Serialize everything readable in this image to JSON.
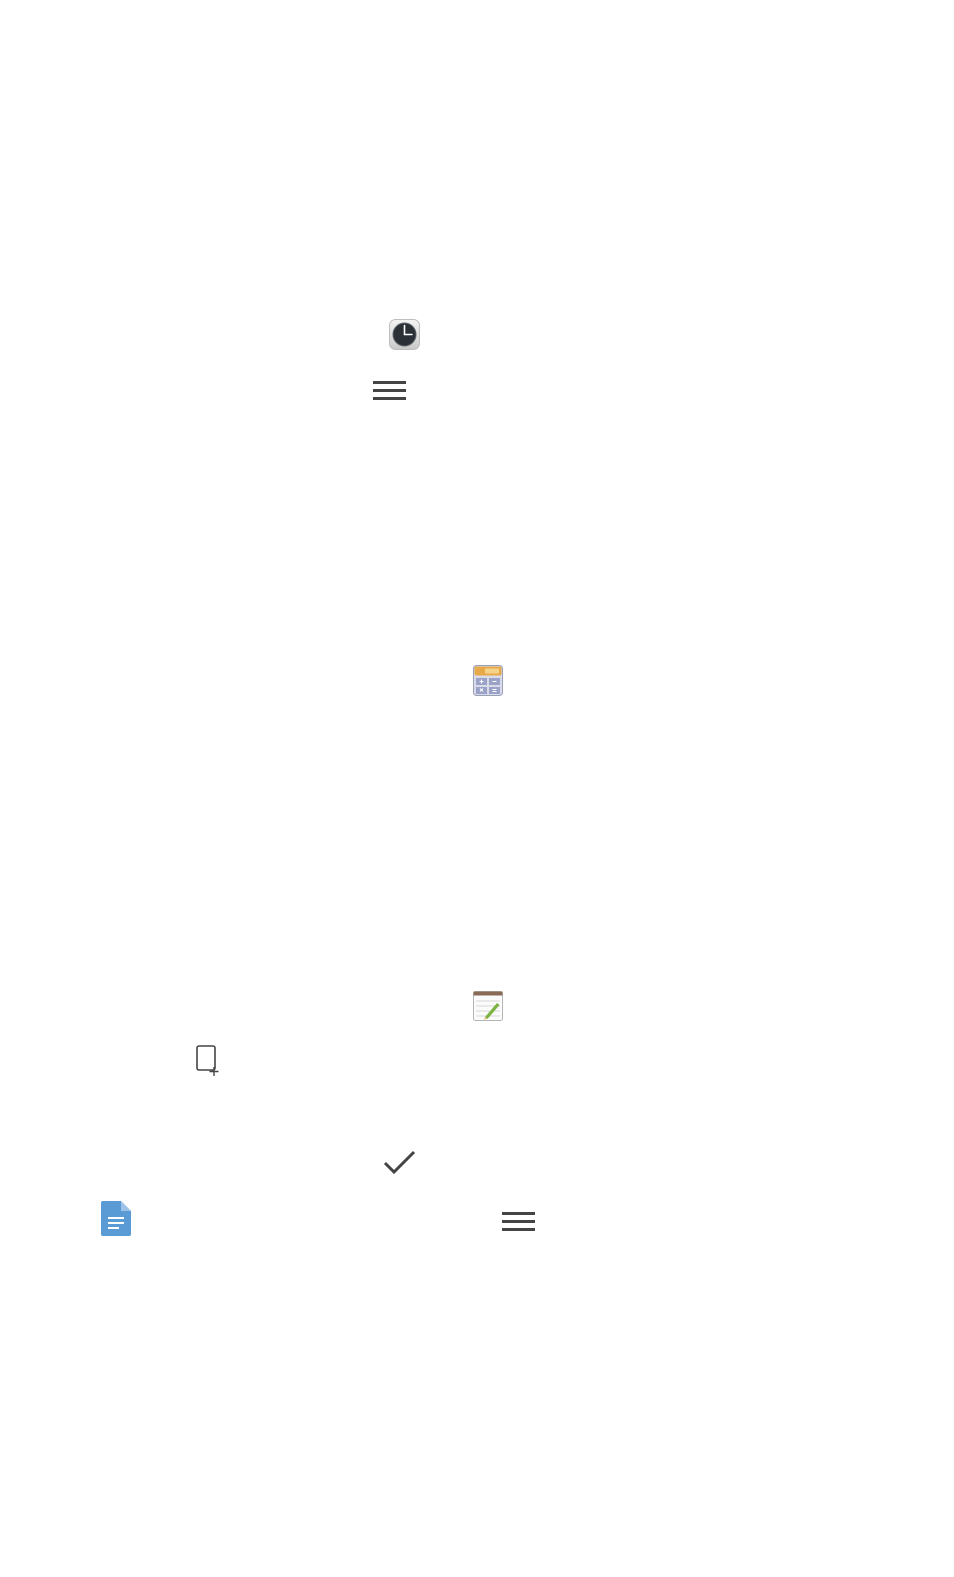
{
  "icons": [
    {
      "name": "clock-app-icon",
      "glyph": "clock"
    },
    {
      "name": "menu-icon",
      "glyph": "hamburger"
    },
    {
      "name": "calculator-app-icon",
      "glyph": "calculator"
    },
    {
      "name": "notepad-app-icon",
      "glyph": "notepad"
    },
    {
      "name": "add-screen-icon",
      "glyph": "phone-plus"
    },
    {
      "name": "checkmark-icon",
      "glyph": "check"
    },
    {
      "name": "document-icon",
      "glyph": "document"
    },
    {
      "name": "menu-icon",
      "glyph": "hamburger"
    }
  ],
  "colors": {
    "background": "#ffffff",
    "icon_dark": "#444444",
    "document_blue": "#5b9bd5",
    "calculator_amber": "#e8a94a",
    "calculator_keys": "#9aa3c7",
    "notepad_pencil": "#7cb342"
  }
}
